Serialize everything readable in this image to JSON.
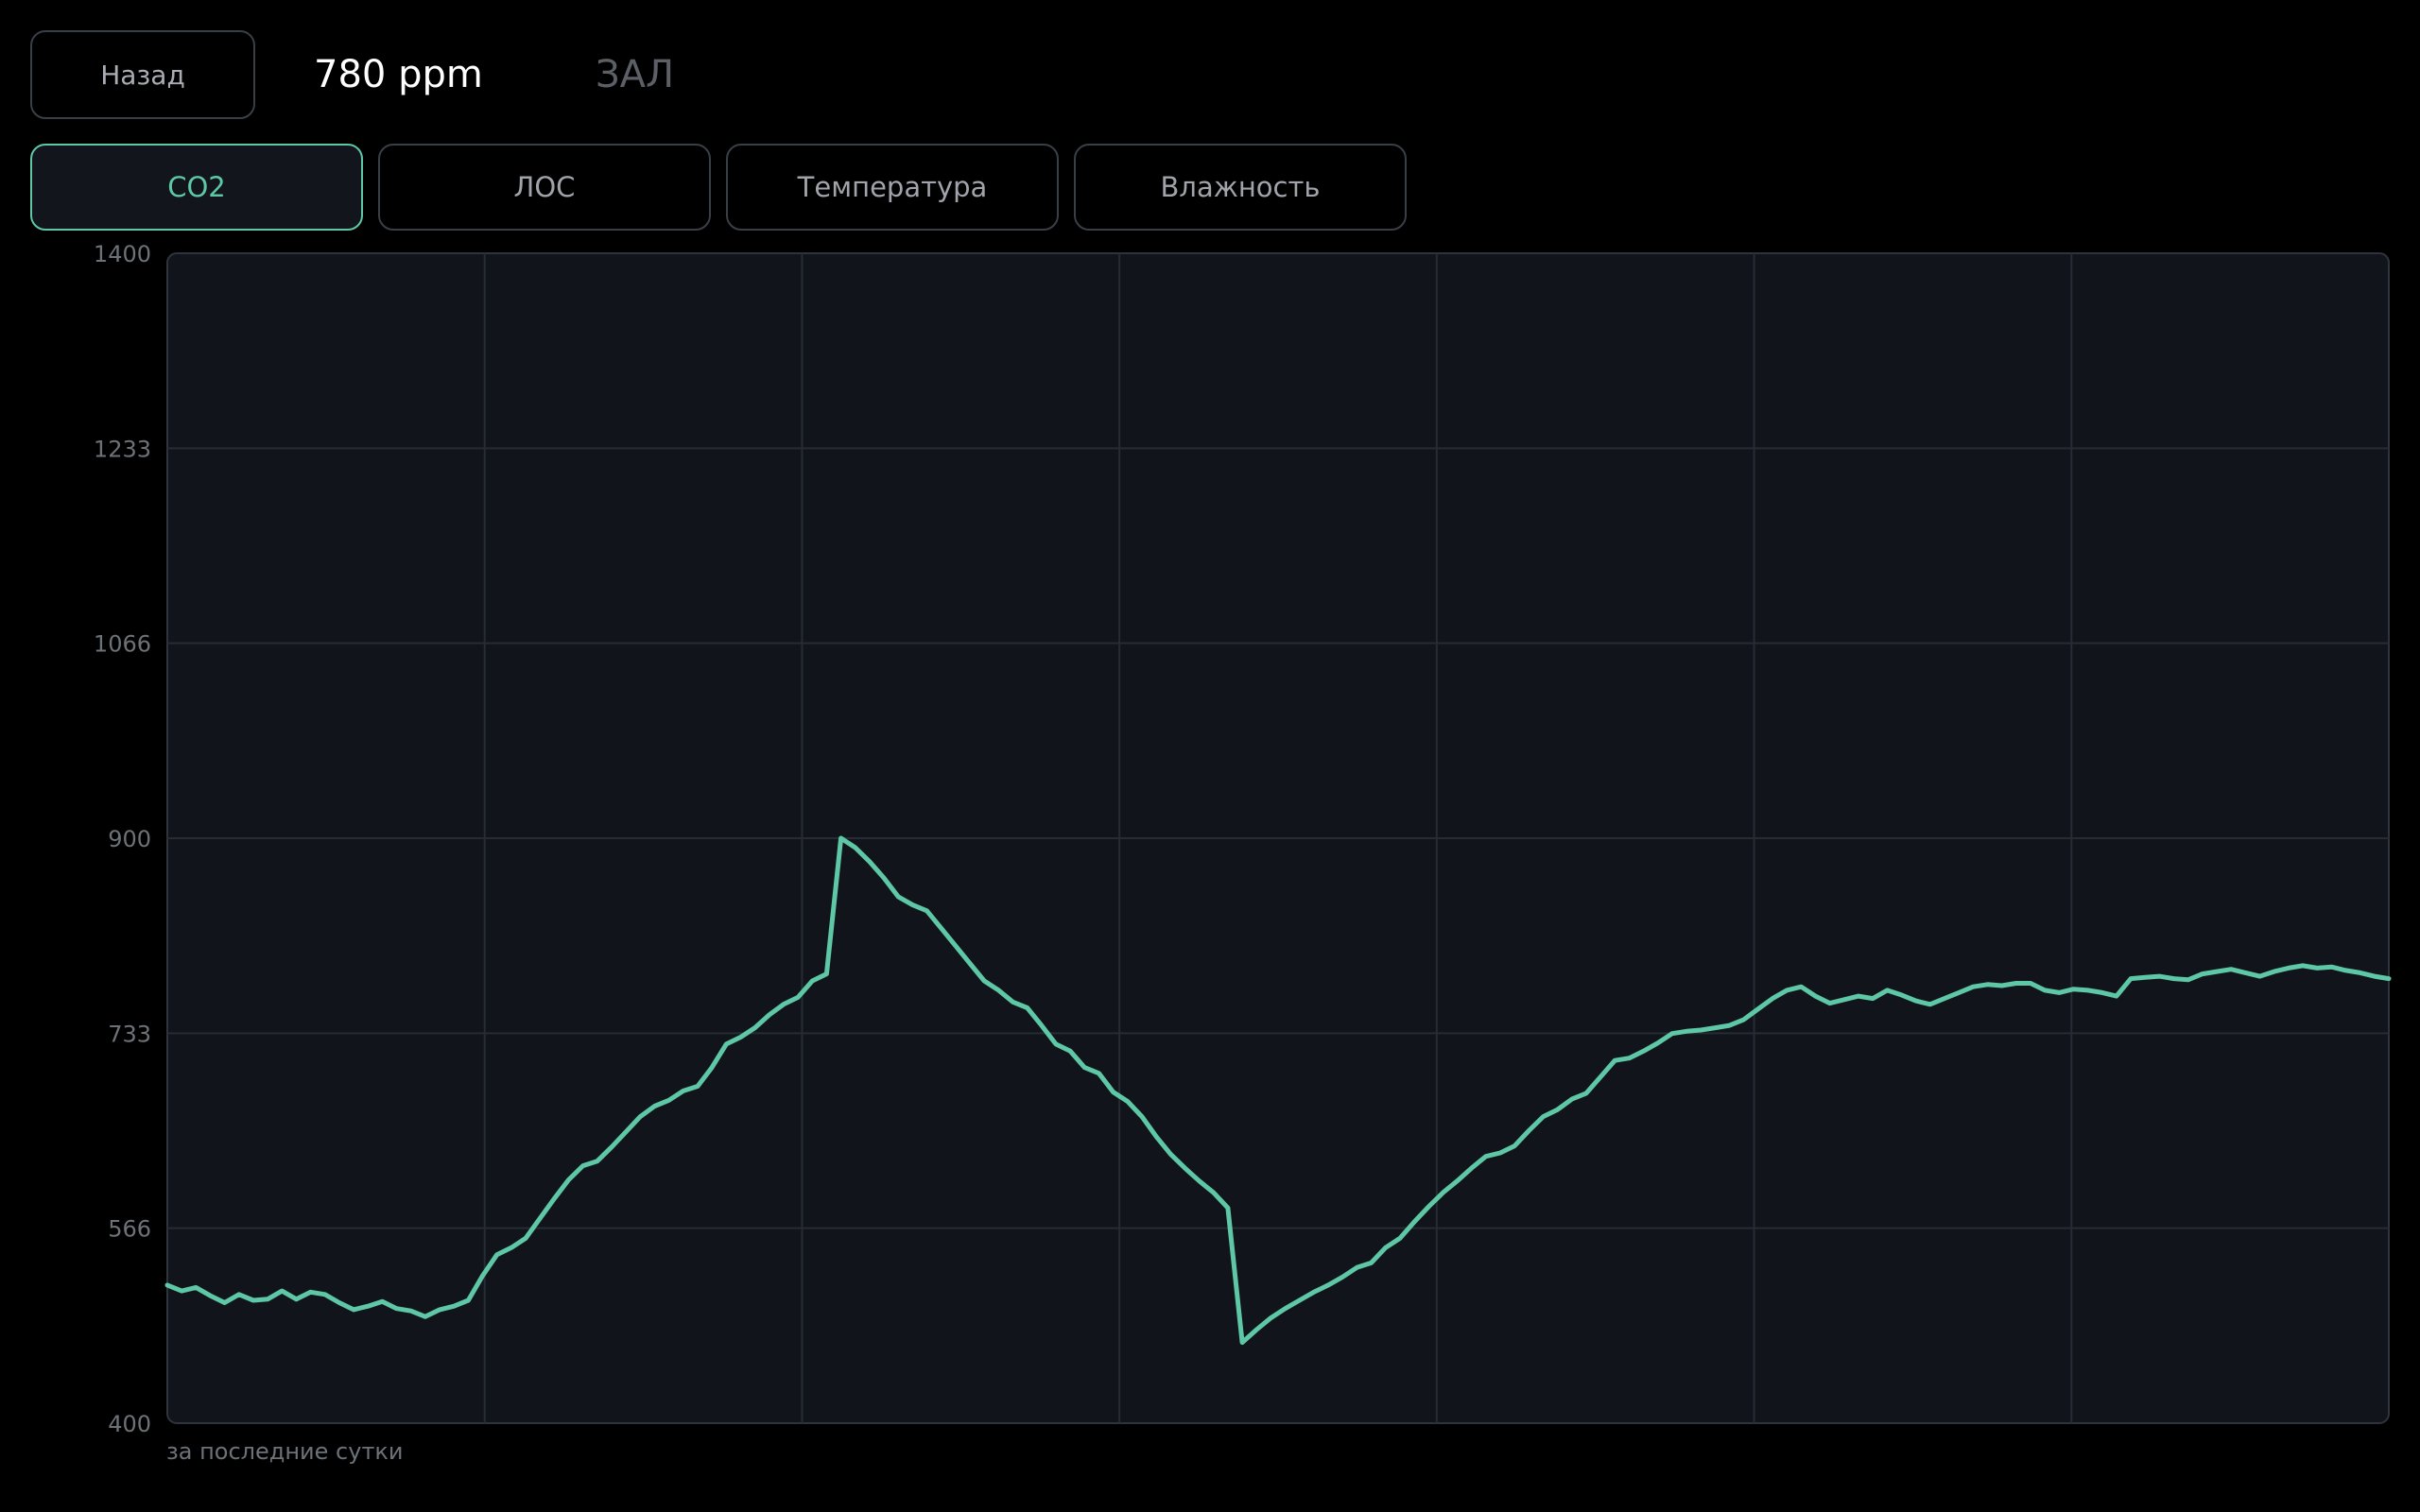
{
  "header": {
    "back_label": "Назад",
    "reading": "780 ppm",
    "room": "ЗАЛ"
  },
  "tabs": [
    {
      "label": "CO2",
      "active": true
    },
    {
      "label": "ЛОС",
      "active": false
    },
    {
      "label": "Температура",
      "active": false
    },
    {
      "label": "Влажность",
      "active": false
    }
  ],
  "colors": {
    "accent": "#5ec7a6",
    "plot_bg": "#11151b",
    "grid": "#262c35",
    "tick_text": "#6d7278"
  },
  "footnote": "за последние сутки",
  "chart_data": {
    "type": "line",
    "title": "",
    "xlabel": "",
    "ylabel": "",
    "ylim": [
      400,
      1400
    ],
    "yticks": [
      "400",
      "566",
      "733",
      "900",
      "1066",
      "1233",
      "1400"
    ],
    "grid": true,
    "series": [
      {
        "values": [
          518,
          513,
          516,
          509,
          503,
          510,
          505,
          506,
          513,
          506,
          512,
          510,
          503,
          497,
          500,
          504,
          498,
          496,
          491,
          497,
          500,
          505,
          526,
          544,
          550,
          558,
          575,
          592,
          608,
          620,
          624,
          636,
          649,
          662,
          671,
          676,
          684,
          688,
          704,
          724,
          730,
          738,
          749,
          758,
          764,
          778,
          784,
          900,
          892,
          880,
          866,
          850,
          843,
          838,
          823,
          808,
          793,
          778,
          770,
          760,
          755,
          740,
          724,
          718,
          704,
          699,
          683,
          675,
          662,
          645,
          630,
          618,
          607,
          597,
          584,
          469,
          480,
          490,
          498,
          505,
          512,
          518,
          525,
          533,
          537,
          550,
          558,
          572,
          585,
          597,
          607,
          618,
          628,
          631,
          637,
          650,
          662,
          668,
          677,
          682,
          696,
          710,
          712,
          718,
          725,
          733,
          735,
          736,
          738,
          740,
          745,
          754,
          763,
          770,
          773,
          765,
          759,
          762,
          765,
          763,
          770,
          766,
          761,
          758,
          763,
          768,
          773,
          775,
          774,
          776,
          776,
          770,
          768,
          771,
          770,
          768,
          765,
          780,
          781,
          782,
          780,
          779,
          784,
          786,
          788,
          785,
          782,
          786,
          789,
          791,
          789,
          790,
          787,
          785,
          782,
          780
        ]
      }
    ]
  }
}
